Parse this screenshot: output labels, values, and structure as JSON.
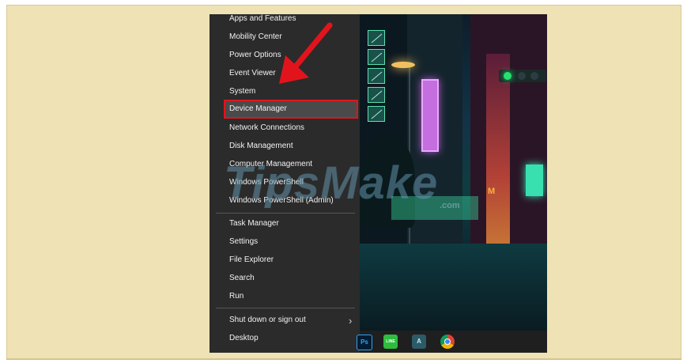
{
  "menu": {
    "items": [
      {
        "label": "Apps and Features"
      },
      {
        "label": "Mobility Center"
      },
      {
        "label": "Power Options"
      },
      {
        "label": "Event Viewer"
      },
      {
        "label": "System"
      },
      {
        "label": "Device Manager",
        "highlighted": true
      },
      {
        "label": "Network Connections"
      },
      {
        "label": "Disk Management"
      },
      {
        "label": "Computer Management"
      },
      {
        "label": "Windows PowerShell"
      },
      {
        "label": "Windows PowerShell (Admin)"
      },
      {
        "label": "Task Manager"
      },
      {
        "label": "Settings"
      },
      {
        "label": "File Explorer"
      },
      {
        "label": "Search"
      },
      {
        "label": "Run"
      },
      {
        "label": "Shut down or sign out",
        "submenu": true
      },
      {
        "label": "Desktop"
      }
    ],
    "chevron": "›"
  },
  "taskbar": {
    "icons": [
      {
        "name": "photoshop-icon",
        "text": "Ps",
        "color": "#2fa3f7"
      },
      {
        "name": "line-icon",
        "text": "LINE",
        "color": "#2ebc3f"
      },
      {
        "name": "app-a-icon",
        "text": "A",
        "color": "#7fc6d8"
      },
      {
        "name": "chrome-icon",
        "text": "",
        "color": "#f0b400"
      }
    ]
  },
  "wallpaper": {
    "sign_letter": "M"
  },
  "watermark": {
    "text": "TipsMake",
    "suffix": ".com"
  },
  "colors": {
    "highlight": "#e1141c",
    "menu_bg": "#2b2b2b",
    "frame_bg": "#efe2b4"
  }
}
